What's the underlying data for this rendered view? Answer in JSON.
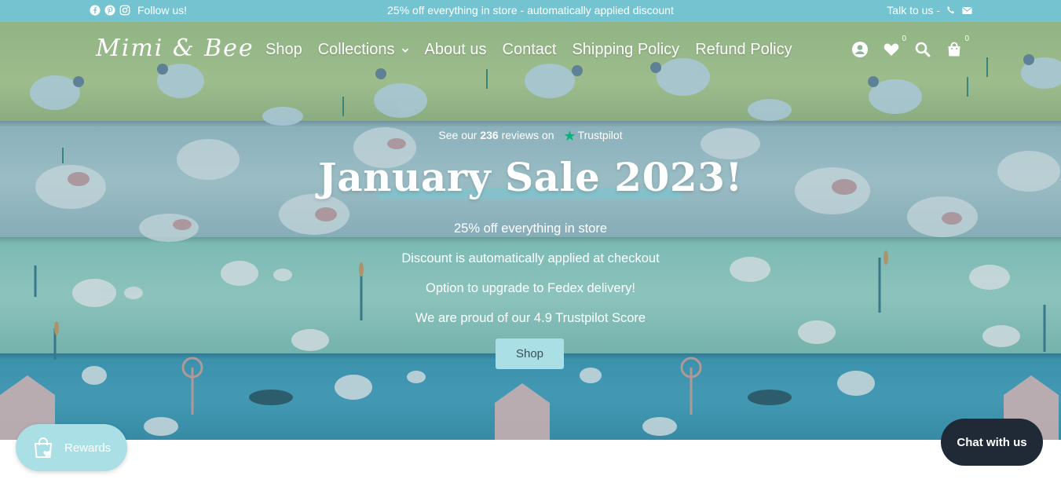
{
  "announcement": {
    "follow_label": "Follow us!",
    "social_icons": [
      "facebook-icon",
      "pinterest-icon",
      "instagram-icon"
    ],
    "message": "25% off everything in store - automatically applied discount",
    "talk_label": "Talk to us -",
    "contact_icons": [
      "phone-icon",
      "mail-icon"
    ]
  },
  "header": {
    "logo_text": "Mimi & Bee",
    "nav": [
      {
        "label": "Shop"
      },
      {
        "label": "Collections",
        "has_dropdown": true
      },
      {
        "label": "About us"
      },
      {
        "label": "Contact"
      },
      {
        "label": "Shipping Policy"
      },
      {
        "label": "Refund Policy"
      }
    ],
    "icons": {
      "account": "account-icon",
      "wishlist": "heart-icon",
      "wishlist_count": "0",
      "search": "search-icon",
      "cart": "cart-icon",
      "cart_count": "0"
    }
  },
  "hero": {
    "trust": {
      "prefix": "See our",
      "count": "236",
      "suffix": "reviews on",
      "brand": "Trustpilot"
    },
    "title": "January Sale 2023!",
    "lines": [
      "25% off everything in store",
      "Discount is automatically applied at checkout",
      "Option to upgrade to Fedex delivery!",
      "We are proud of our 4.9 Trustpilot Score"
    ],
    "button_label": "Shop"
  },
  "widgets": {
    "rewards_label": "Rewards",
    "chat_label": "Chat with us"
  },
  "colors": {
    "announcement_bg": "#74c3d1",
    "button_bg": "#a9dfe5",
    "chat_bg": "#1f2a36",
    "trustpilot_green": "#00b67a"
  }
}
